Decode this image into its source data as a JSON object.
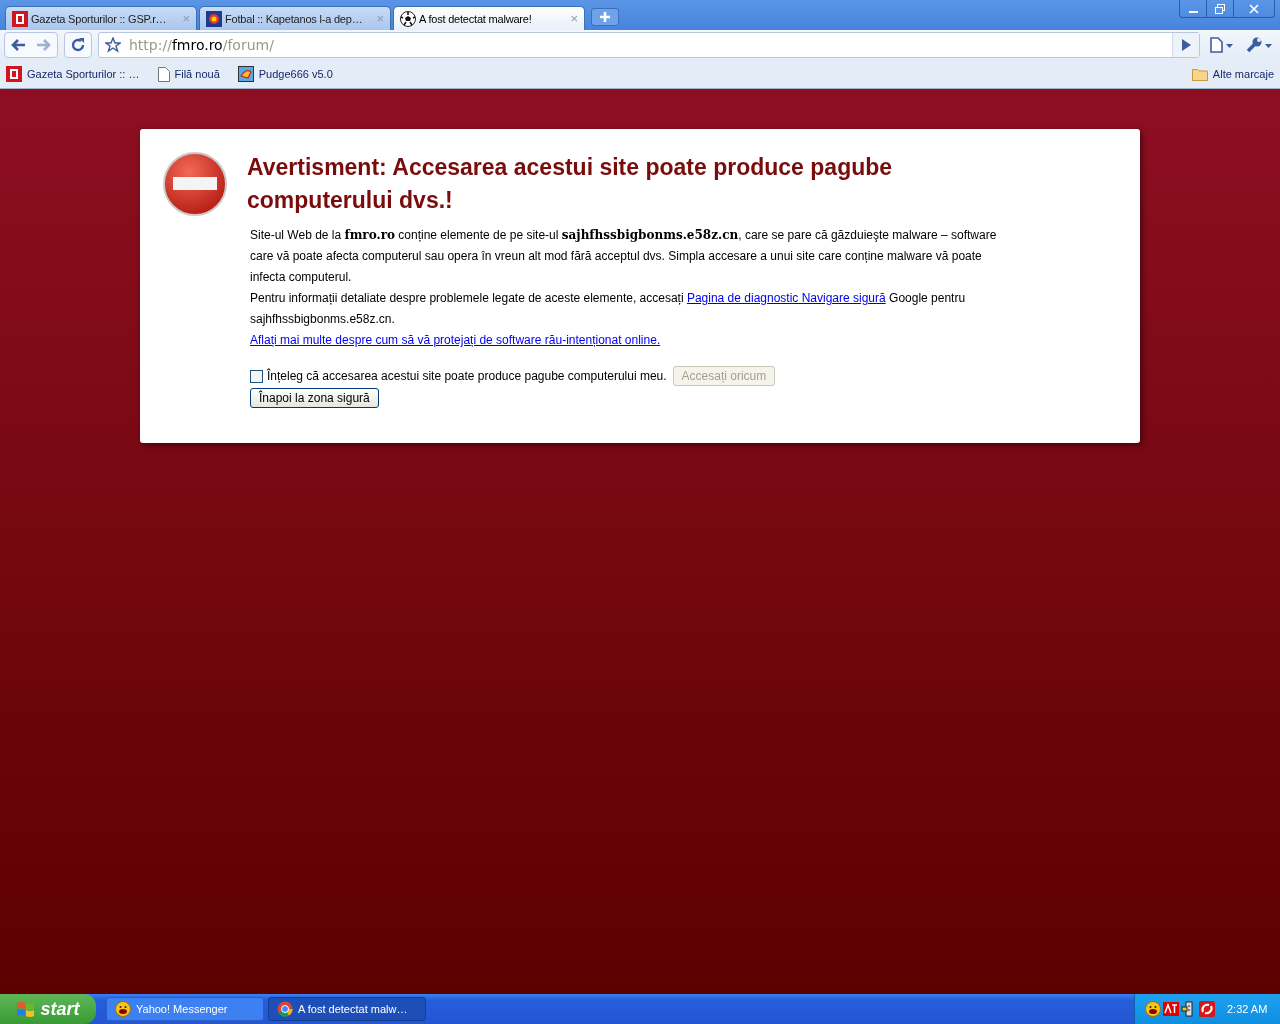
{
  "tabs": [
    {
      "title": "Gazeta Sporturilor :: GSP.r…",
      "close": "×",
      "selected": false
    },
    {
      "title": "Fotbal :: Kapetanos l-a dep…",
      "close": "×",
      "selected": false
    },
    {
      "title": "A fost detectat malware!",
      "close": "×",
      "selected": true
    }
  ],
  "address_bar": {
    "scheme": "http://",
    "host": "fmro.ro",
    "path": "/forum/"
  },
  "bookmarks": [
    {
      "label": "Gazeta Sporturilor :: …"
    },
    {
      "label": "Filă nouă"
    },
    {
      "label": "Pudge666 v5.0"
    }
  ],
  "other_bookmarks": "Alte marcaje",
  "warning": {
    "title": "Avertisment: Accesarea acestui site poate produce pagube computerului dvs.!",
    "paragraph": "Site-ul Web de la **fmro.ro** conține elemente de pe site-ul **sajhfhssbigbonms.e58z.cn**, care se pare că găzduieşte malware – software care vă poate afecta computerul sau opera în vreun alt mod fără acceptul dvs. Simpla accesare a unui site care conține malware vă poate infecta computerul.",
    "details_before": "Pentru informații detaliate despre problemele legate de aceste elemente, accesați",
    "details_link": "Pagina de diagnostic Navigare sigură",
    "details_after": "Google pentru sajhfhssbigbonms.e58z.cn.",
    "learn_more": "Aflați mai multe despre cum să vă protejați de software rău-intenționat online.",
    "checkbox": {
      "label": "Înțeleg că accesarea acestui site poate produce pagube computerului meu.",
      "checked": false
    },
    "proceed_button": {
      "label": "Accesați oricum",
      "disabled": true
    },
    "back_button": {
      "label": "Înapoi la zona sigură"
    }
  },
  "taskbar": {
    "start": "start",
    "buttons": [
      {
        "label": "Yahoo! Messenger",
        "selected": false
      },
      {
        "label": "A fost detectat malw…",
        "selected": true
      }
    ],
    "clock": "2:32 AM"
  }
}
